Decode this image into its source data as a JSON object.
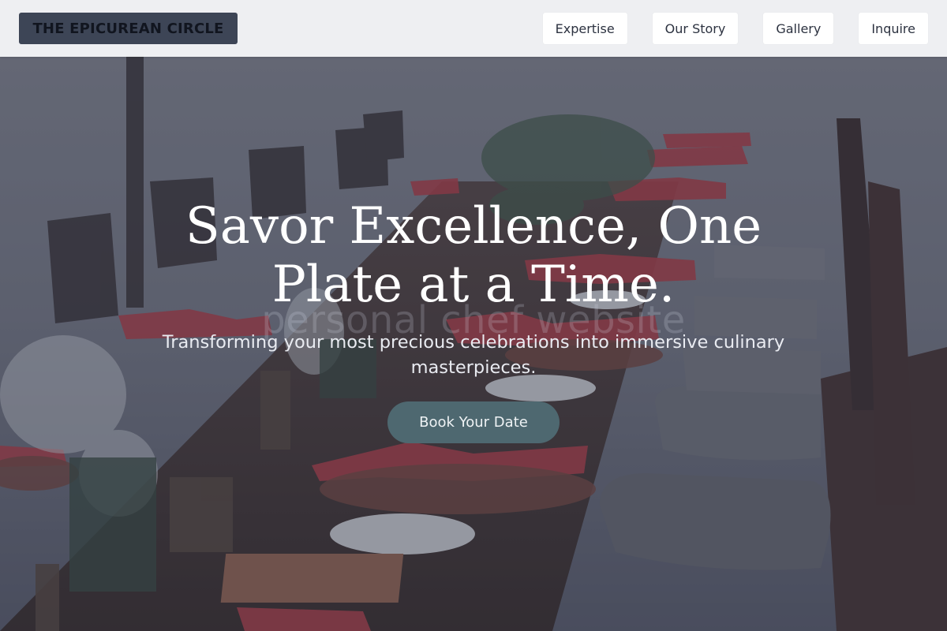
{
  "page": {
    "background_tint": "#2e3140",
    "accent": "#4e6870"
  },
  "navbar": {
    "brand": "THE EPICUREAN CIRCLE",
    "links": [
      {
        "label": "Expertise"
      },
      {
        "label": "Our Story"
      },
      {
        "label": "Gallery"
      },
      {
        "label": "Inquire"
      }
    ]
  },
  "hero": {
    "image_alt_icon": "dinner-table-photo",
    "watermark": "personal chef website",
    "title": "Savor Excellence, One Plate at a Time.",
    "subtitle": "Transforming your most precious celebrations into immersive culinary masterpieces.",
    "cta_label": "Book Your Date"
  }
}
